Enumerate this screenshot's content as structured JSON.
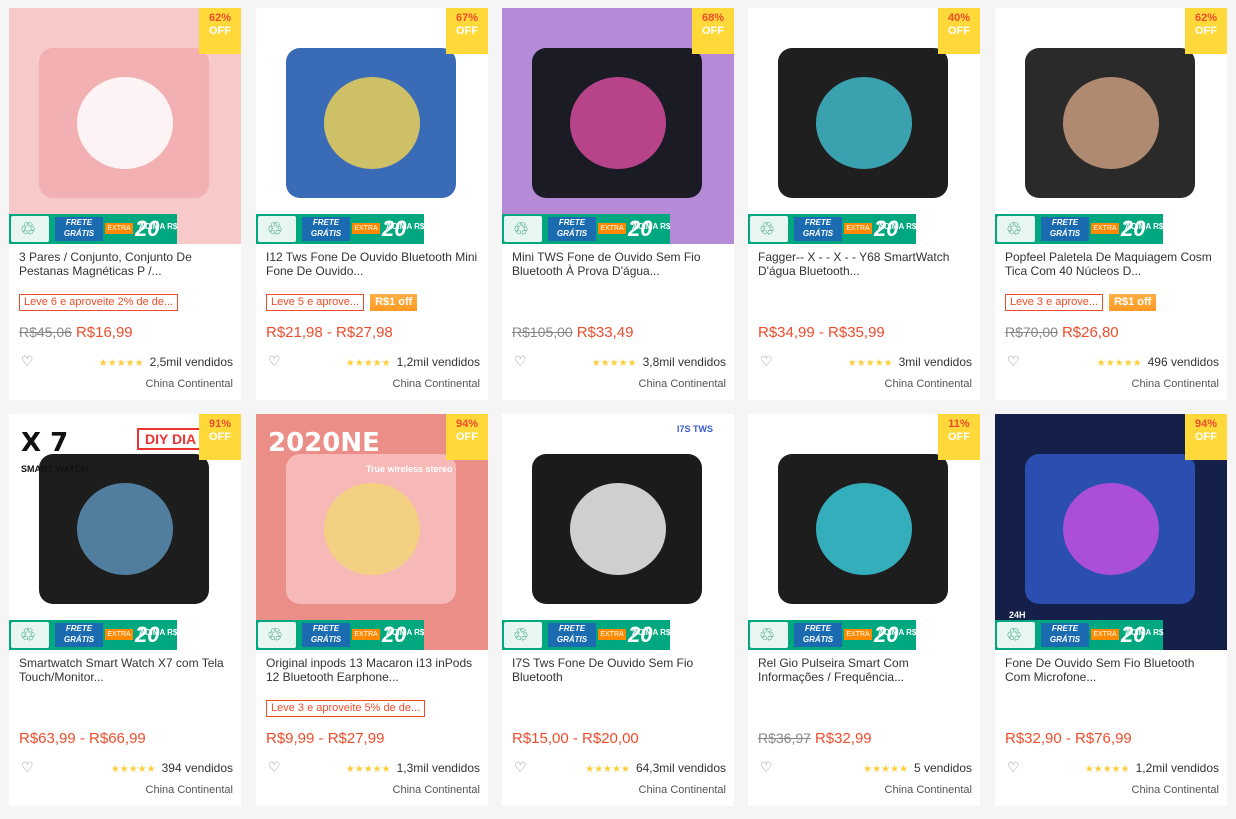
{
  "products": [
    {
      "discount": "62%",
      "off": "OFF",
      "title": "3 Pares / Conjunto, Conjunto De Pestanas Magnéticas P /...",
      "promo": "Leve 6 e aproveite 2% de de...",
      "promo_extra": "",
      "old_price": "R$45,06",
      "price": "R$16,99",
      "sold": "2,5mil vendidos",
      "location": "China Continental",
      "img_colors": [
        "#f7c9c9",
        "#f3b0b2",
        "#ffffff"
      ]
    },
    {
      "discount": "67%",
      "off": "OFF",
      "title": "I12 Tws Fone De Ouvido Bluetooth Mini Fone De Ouvido...",
      "promo": "Leve 5 e aprove...",
      "promo_extra": "R$1 off",
      "old_price": "",
      "price": "R$21,98 - R$27,98",
      "sold": "1,2mil vendidos",
      "location": "China Continental",
      "img_colors": [
        "#ffffff",
        "#3a6bb7",
        "#e9cf58"
      ]
    },
    {
      "discount": "68%",
      "off": "OFF",
      "title": "Mini TWS Fone de Ouvido Sem Fio Bluetooth À Prova D'água...",
      "promo": "",
      "promo_extra": "",
      "old_price": "R$105,00",
      "price": "R$33,49",
      "sold": "3,8mil vendidos",
      "location": "China Continental",
      "img_colors": [
        "#b58ad6",
        "#1b1b25",
        "#d24b9b"
      ]
    },
    {
      "discount": "40%",
      "off": "OFF",
      "title": "Fagger-- X - - X - - Y68 SmartWatch D'água Bluetooth...",
      "promo": "",
      "promo_extra": "",
      "old_price": "",
      "price": "R$34,99 - R$35,99",
      "sold": "3mil vendidos",
      "location": "China Continental",
      "img_colors": [
        "#ffffff",
        "#1f1f1f",
        "#3fb9c9"
      ]
    },
    {
      "discount": "62%",
      "off": "OFF",
      "title": "Popfeel Paletela De Maquiagem Cosm Tica Com 40 Núcleos D...",
      "promo": "Leve 3 e aprove...",
      "promo_extra": "R$1 off",
      "old_price": "R$70,00",
      "price": "R$26,80",
      "sold": "496 vendidos",
      "location": "China Continental",
      "img_colors": [
        "#ffffff",
        "#2a2a2a",
        "#c89b7c"
      ]
    },
    {
      "discount": "91%",
      "off": "OFF",
      "title": "Smartwatch Smart Watch X7 com Tela Touch/Monitor...",
      "promo": "",
      "promo_extra": "",
      "old_price": "",
      "price": "R$63,99 - R$66,99",
      "sold": "394 vendidos",
      "location": "China Continental",
      "img_colors": [
        "#ffffff",
        "#1d1d1d",
        "#5a8fb5"
      ],
      "brand_big": "X 7",
      "brand_small": "SMART WATCH",
      "ribbon": "DIY DIA"
    },
    {
      "discount": "94%",
      "off": "OFF",
      "title": "Original inpods 13 Macaron i13 inPods 12 Bluetooth Earphone...",
      "promo": "Leve 3 e aproveite 5% de de...",
      "promo_extra": "",
      "old_price": "",
      "price": "R$9,99 - R$27,99",
      "sold": "1,3mil vendidos",
      "location": "China Continental",
      "img_colors": [
        "#ec8e88",
        "#f7b9b7",
        "#f3d37a"
      ],
      "brand_big": "2020NE",
      "brand_small": "True wireless stereo"
    },
    {
      "discount": "",
      "off": "",
      "title": "I7S Tws Fone De Ouvido Sem Fio Bluetooth",
      "promo": "",
      "promo_extra": "",
      "old_price": "",
      "price": "R$15,00 - R$20,00",
      "sold": "64,3mil vendidos",
      "location": "China Continental",
      "img_colors": [
        "#ffffff",
        "#1b1b1b",
        "#eeeeee"
      ],
      "brand_small": "I7S TWS"
    },
    {
      "discount": "11%",
      "off": "OFF",
      "title": "Rel Gio Pulseira Smart Com Informações / Frequência...",
      "promo": "",
      "promo_extra": "",
      "old_price": "R$36,97",
      "price": "R$32,99",
      "sold": "5 vendidos",
      "location": "China Continental",
      "img_colors": [
        "#ffffff",
        "#1d1d1d",
        "#39c8d8"
      ]
    },
    {
      "discount": "94%",
      "off": "OFF",
      "title": "Fone De Ouvido Sem Fio Bluetooth Com Microfone...",
      "promo": "",
      "promo_extra": "",
      "old_price": "",
      "price": "R$32,90 - R$76,99",
      "sold": "1,2mil vendidos",
      "location": "China Continental",
      "img_colors": [
        "#14204a",
        "#2a4fb0",
        "#c24ee0"
      ],
      "brand_small": "24H"
    }
  ],
  "frete": {
    "line1": "FRETE",
    "line2": "GRÁTIS",
    "tag": "EXTRA",
    "small": "ACIMA R$",
    "amount": "20"
  },
  "ui": {
    "heart": "♡",
    "stars": "★★★★★",
    "leaf": "♲"
  }
}
